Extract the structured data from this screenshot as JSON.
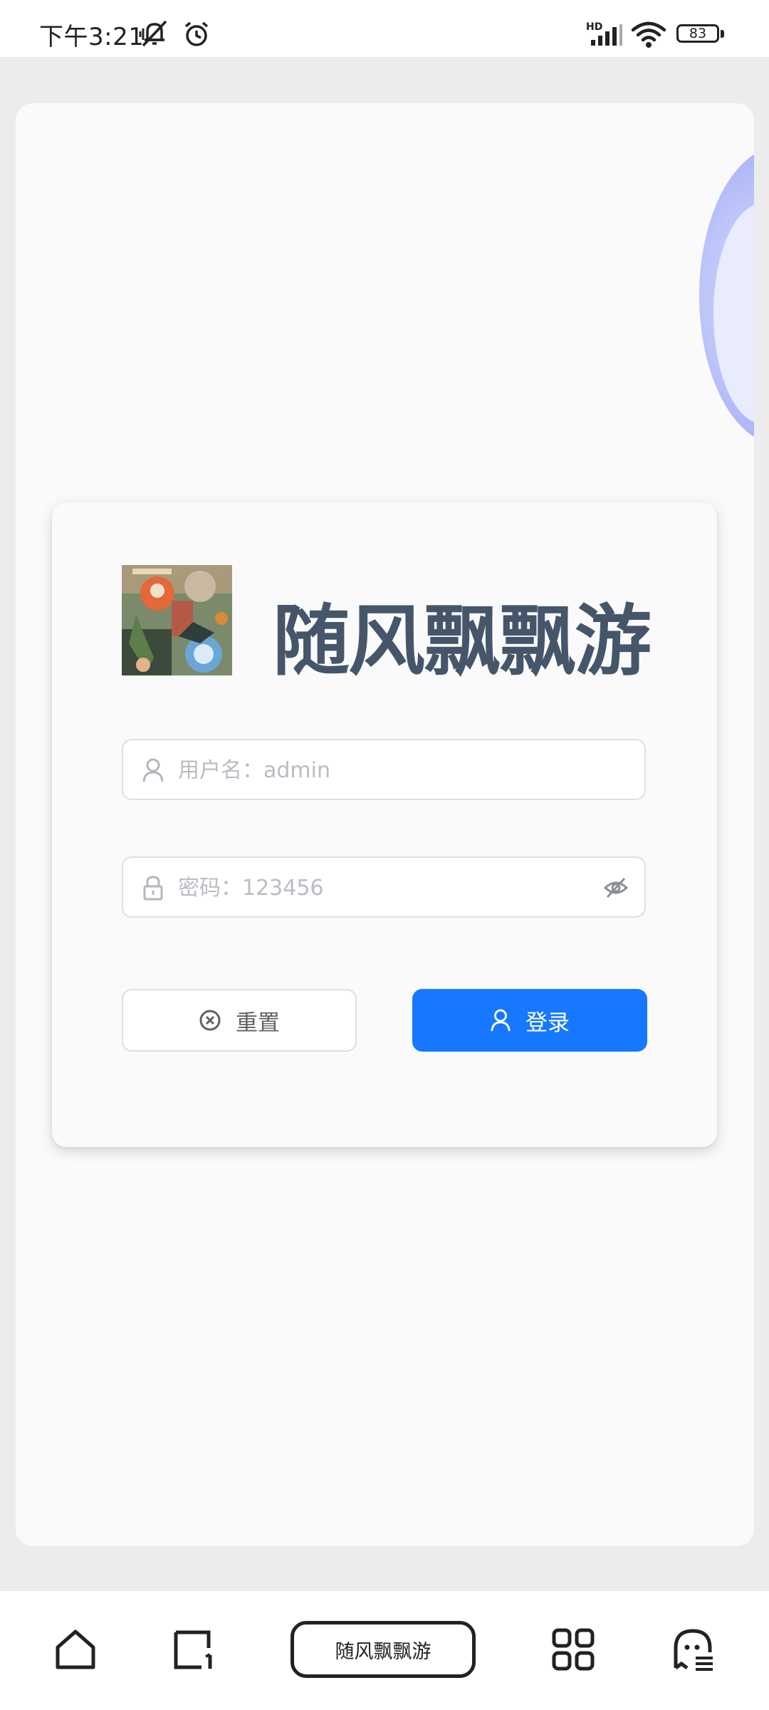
{
  "status_bar": {
    "time": "下午3:21",
    "network_label": "HD",
    "battery": "83",
    "icons": [
      "bell-muted-icon",
      "alarm-icon",
      "signal-icon",
      "wifi-icon",
      "battery-icon"
    ]
  },
  "app": {
    "title": "随风飘飘游",
    "accent_color": "#1677ff",
    "title_color": "#45566a"
  },
  "login_form": {
    "username": {
      "placeholder": "用户名：admin",
      "value": "",
      "icon": "user-icon"
    },
    "password": {
      "placeholder": "密码：123456",
      "value": "",
      "icon": "lock-icon",
      "toggle_icon": "eye-off-icon"
    },
    "reset_label": "重置",
    "login_label": "登录"
  },
  "bottom_nav": {
    "items": [
      "home-icon",
      "recent-tab-icon",
      "apps-grid-icon",
      "ghost-menu-icon"
    ],
    "center_label": "随风飘飘游"
  }
}
